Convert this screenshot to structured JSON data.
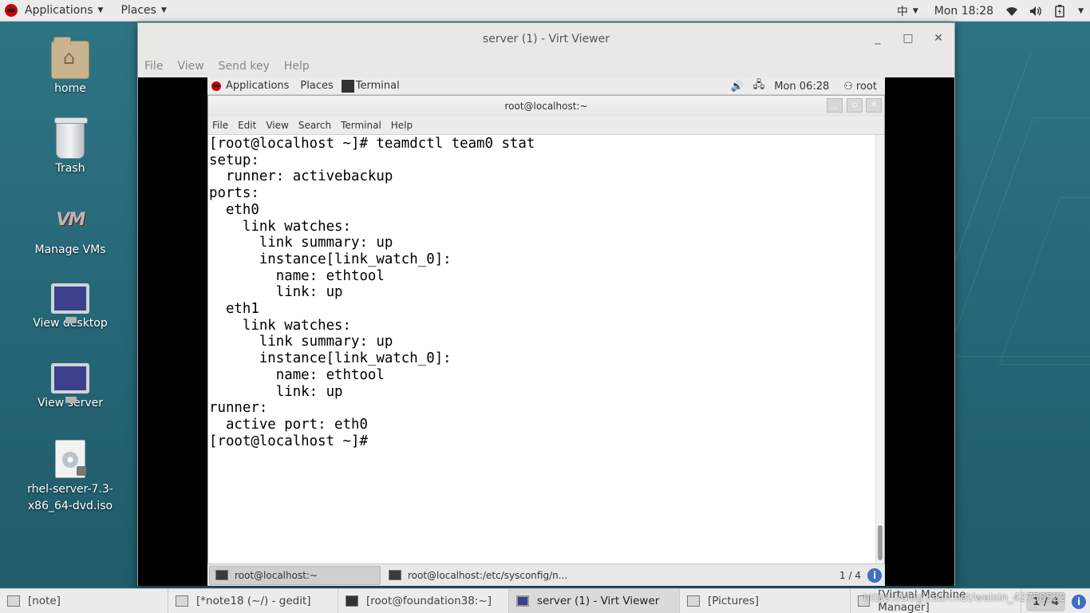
{
  "top_panel": {
    "applications": "Applications",
    "places": "Places",
    "input_method": "中",
    "clock": "Mon 18:28"
  },
  "desktop_icons": [
    {
      "label": "home"
    },
    {
      "label": "Trash"
    },
    {
      "label": "Manage VMs",
      "logo_text": "VM"
    },
    {
      "label": "View desktop"
    },
    {
      "label": "View server"
    },
    {
      "label": "rhel-server-7.3-x86_64-dvd.iso"
    }
  ],
  "virt_viewer": {
    "title": "server (1) - Virt Viewer",
    "menu": [
      "File",
      "View",
      "Send key",
      "Help"
    ]
  },
  "guest": {
    "top_panel": {
      "applications": "Applications",
      "places": "Places",
      "terminal_tab": "Terminal",
      "clock": "Mon 06:28",
      "user": "root"
    },
    "terminal": {
      "title": "root@localhost:~",
      "menu": [
        "File",
        "Edit",
        "View",
        "Search",
        "Terminal",
        "Help"
      ],
      "lines": [
        "[root@localhost ~]# teamdctl team0 stat",
        "setup:",
        "  runner: activebackup",
        "ports:",
        "  eth0",
        "    link watches:",
        "      link summary: up",
        "      instance[link_watch_0]:",
        "        name: ethtool",
        "        link: up",
        "  eth1",
        "    link watches:",
        "      link summary: up",
        "      instance[link_watch_0]:",
        "        name: ethtool",
        "        link: up",
        "runner:",
        "  active port: eth0",
        "[root@localhost ~]#"
      ]
    },
    "taskbar": {
      "tasks": [
        "root@localhost:~",
        "root@localhost:/etc/sysconfig/n..."
      ],
      "pager": "1 / 4"
    }
  },
  "bottom_panel": {
    "tasks": [
      "[note]",
      "[*note18 (~/) - gedit]",
      "[root@foundation38:~]",
      "server (1) - Virt Viewer",
      "[Pictures]",
      "[Virtual Machine Manager]"
    ],
    "pager": "1 / 4",
    "watermark": "https://blog.csdn.net/weixin_42758522"
  }
}
